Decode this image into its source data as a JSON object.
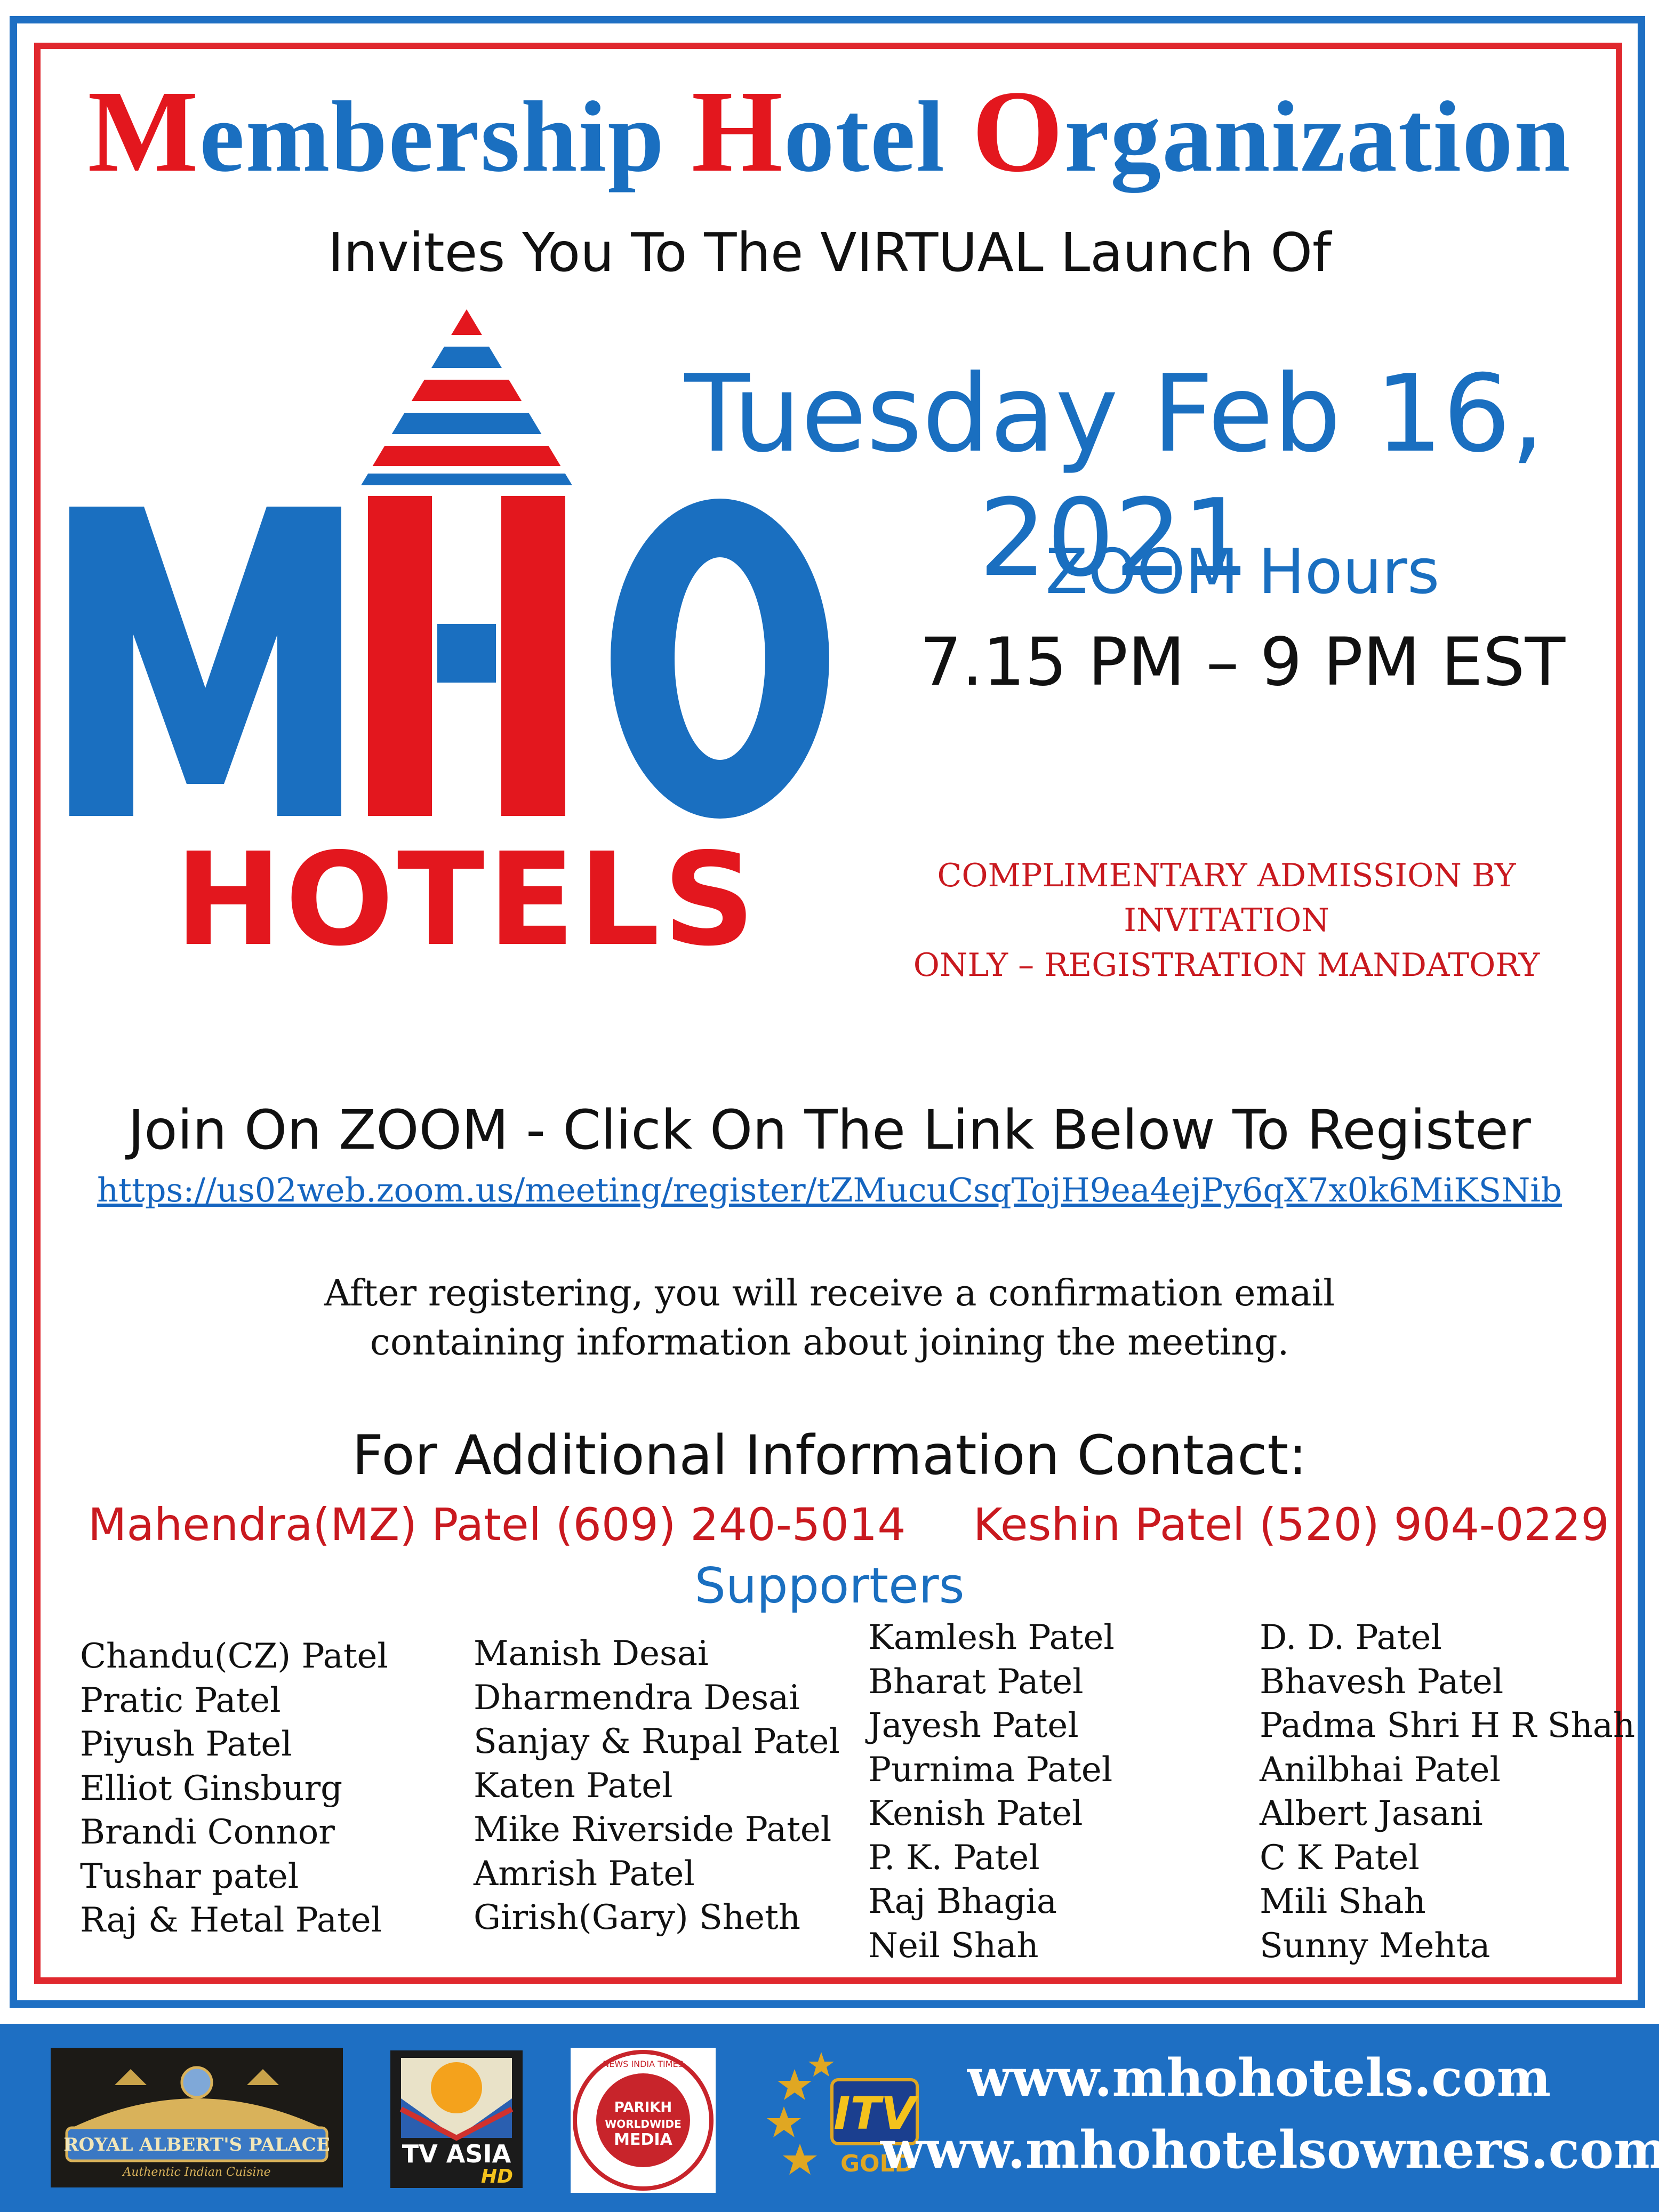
{
  "header": {
    "title_parts": [
      {
        "cap": "M",
        "rest": "embership "
      },
      {
        "cap": "H",
        "rest": "otel "
      },
      {
        "cap": "O",
        "rest": "rganization"
      }
    ],
    "invites": "Invites You To The VIRTUAL Launch Of"
  },
  "logo": {
    "letters": "MHO",
    "wordmark": "HOTELS",
    "colors": {
      "blue": "#1a6fc0",
      "red": "#e3171e"
    }
  },
  "event": {
    "date": "Tuesday Feb 16, 2021",
    "zoom_hours_label": "ZOOM Hours",
    "zoom_time": "7.15 PM – 9 PM EST",
    "admission_line1": "COMPLIMENTARY ADMISSION  BY INVITATION",
    "admission_line2": "ONLY – REGISTRATION MANDATORY"
  },
  "registration": {
    "join_text": "Join On ZOOM - Click On The Link Below To Register",
    "link": "https://us02web.zoom.us/meeting/register/tZMucuCsqTojH9ea4ejPy6qX7x0k6MiKSNib",
    "after_line1": "After registering, you will receive a confirmation email",
    "after_line2": "containing information about joining the meeting."
  },
  "contact": {
    "heading": "For Additional Information Contact:",
    "person1": "Mahendra(MZ) Patel   (609) 240-5014",
    "person2": "Keshin Patel  (520) 904-0229"
  },
  "supporters": {
    "heading": "Supporters",
    "columns": [
      [
        "Chandu(CZ) Patel",
        "Pratic Patel",
        "Piyush Patel",
        "Elliot Ginsburg",
        "Brandi Connor",
        "Tushar patel",
        "Raj & Hetal Patel"
      ],
      [
        "Manish Desai",
        "Dharmendra Desai",
        "Sanjay & Rupal Patel",
        "Katen Patel",
        "Mike Riverside Patel",
        "Amrish Patel",
        "Girish(Gary) Sheth"
      ],
      [
        "Kamlesh Patel",
        "Bharat Patel",
        "Jayesh Patel",
        "Purnima Patel",
        "Kenish Patel",
        "P. K. Patel",
        "Raj Bhagia",
        "Neil Shah"
      ],
      [
        "D. D. Patel",
        "Bhavesh Patel",
        "Padma Shri H R Shah",
        "Anilbhai Patel",
        "Albert Jasani",
        "C K Patel",
        "Mili Shah",
        "Sunny Mehta"
      ]
    ]
  },
  "footer": {
    "url1": "www.mhohotels.com",
    "url2": "www.mhohotelsowners.com",
    "sponsors": [
      {
        "name": "ROYAL ALBERT'S PALACE",
        "tagline": "Authentic Indian Cuisine"
      },
      {
        "name": "TV ASIA",
        "tagline": "HD"
      },
      {
        "name": "PARIKH WORLDWIDE MEDIA",
        "tagline": "NEWS INDIA TIMES"
      },
      {
        "name": "ITV",
        "tagline": "GOLD"
      }
    ]
  },
  "colors": {
    "frame_blue": "#1e6fc3",
    "frame_red": "#e0282e",
    "accent_blue": "#1a6fc0",
    "accent_red": "#c9191f"
  }
}
